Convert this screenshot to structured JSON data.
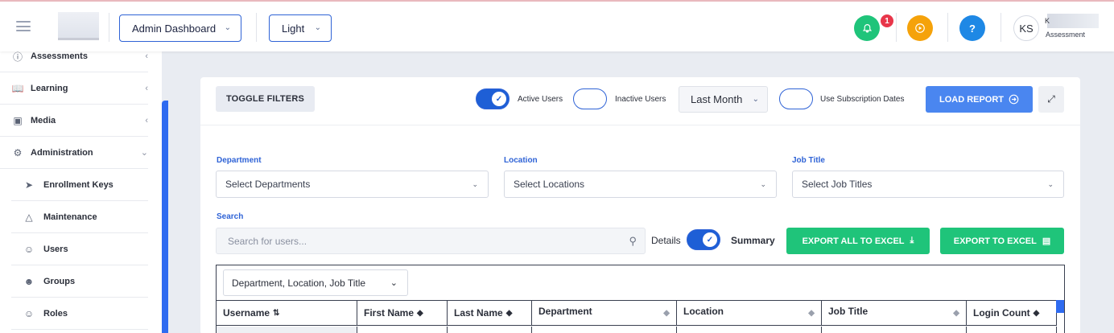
{
  "header": {
    "dashboard_select": "Admin Dashboard",
    "theme_select": "Light",
    "notification_count": "1",
    "avatar_initials": "KS",
    "user_initial": "K",
    "user_role": "Assessment"
  },
  "sidebar": {
    "items": [
      {
        "label": "Assessments",
        "icon": "question-circle-icon"
      },
      {
        "label": "Learning",
        "icon": "book-icon"
      },
      {
        "label": "Media",
        "icon": "image-icon"
      },
      {
        "label": "Administration",
        "icon": "gear-icon"
      },
      {
        "label": "Enrollment Keys",
        "icon": "send-icon"
      },
      {
        "label": "Maintenance",
        "icon": "warning-icon"
      },
      {
        "label": "Users",
        "icon": "users-icon"
      },
      {
        "label": "Groups",
        "icon": "user-plus-icon"
      },
      {
        "label": "Roles",
        "icon": "user-check-icon"
      }
    ]
  },
  "report": {
    "toggle_filters": "TOGGLE FILTERS",
    "active_users": "Active Users",
    "inactive_users": "Inactive Users",
    "period": "Last Month",
    "use_subscription_dates": "Use Subscription Dates",
    "load_report": "LOAD REPORT",
    "active_users_on": true,
    "inactive_users_on": false,
    "subscription_dates_on": false
  },
  "filters": {
    "department_label": "Department",
    "department_placeholder": "Select Departments",
    "location_label": "Location",
    "location_placeholder": "Select Locations",
    "job_title_label": "Job Title",
    "job_title_placeholder": "Select Job Titles",
    "search_label": "Search",
    "search_placeholder": "Search for users...",
    "details_label": "Details",
    "summary_label": "Summary",
    "export_all": "EXPORT ALL TO EXCEL",
    "export": "EXPORT TO EXCEL"
  },
  "table": {
    "grouping": "Department, Location, Job Title",
    "columns": [
      "Username",
      "First Name",
      "Last Name",
      "Department",
      "Location",
      "Job Title",
      "Login Count"
    ]
  },
  "colors": {
    "primary": "#2f63d6",
    "green": "#1fc47a",
    "notify": "#1fc47a",
    "orange": "#f5a20a",
    "help": "#1e88e5"
  }
}
